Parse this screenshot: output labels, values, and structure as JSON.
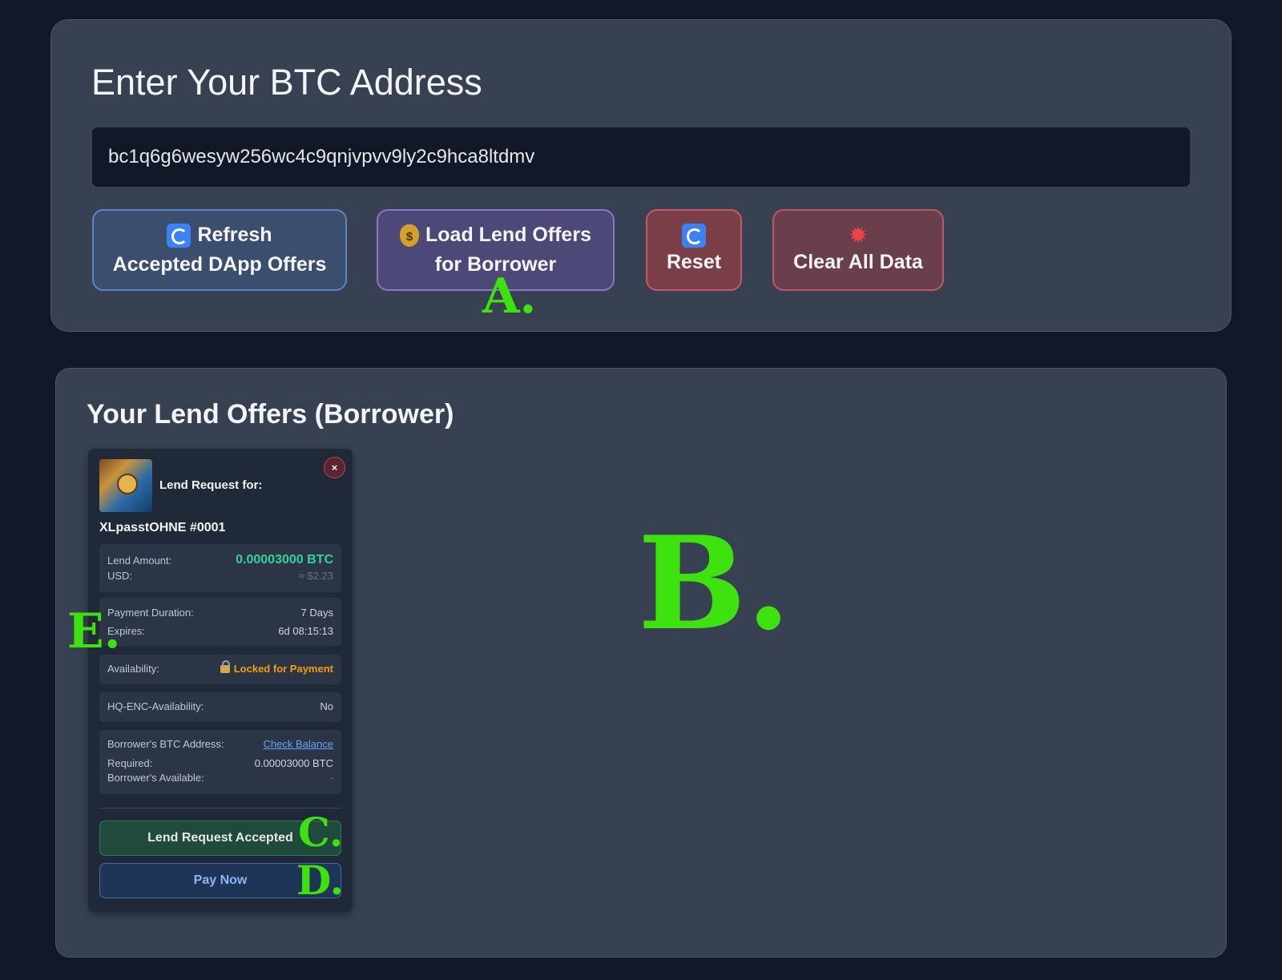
{
  "address_panel": {
    "title": "Enter Your BTC Address",
    "address_value": "bc1q6g6wesyw256wc4c9qnjvpvv9ly2c9hca8ltdmv",
    "buttons": {
      "refresh_line1": "Refresh",
      "refresh_line2": "Accepted DApp Offers",
      "load_line1": "Load Lend Offers",
      "load_line2": "for Borrower",
      "reset": "Reset",
      "clear": "Clear All Data"
    },
    "icons": {
      "money_glyph": "$",
      "boom_glyph": "✹"
    }
  },
  "offers_panel": {
    "title": "Your Lend Offers (Borrower)",
    "card": {
      "header": "Lend Request for:",
      "close_glyph": "×",
      "nft_name": "XLpasstOHNE #0001",
      "lend_amount_label": "Lend Amount:",
      "lend_amount_value": "0.00003000 BTC",
      "usd_label": "USD:",
      "usd_value": "≈ $2.23",
      "duration_label": "Payment Duration:",
      "duration_value": "7 Days",
      "expires_label": "Expires:",
      "expires_value": "6d 08:15:13",
      "availability_label": "Availability:",
      "availability_value": "Locked for Payment",
      "hq_label": "HQ-ENC-Availability:",
      "hq_value": "No",
      "borrower_addr_label": "Borrower's BTC Address:",
      "check_balance": "Check Balance",
      "required_label": "Required:",
      "required_value": "0.00003000 BTC",
      "borrower_available_label": "Borrower's Available:",
      "borrower_available_value": "-",
      "accepted_button": "Lend Request Accepted",
      "pay_button": "Pay Now"
    }
  },
  "annotations": {
    "A": "A.",
    "B": "B.",
    "C": "C.",
    "D": "D.",
    "E": "E."
  },
  "colors": {
    "background": "#111827",
    "panel": "#374151",
    "accent_green": "#34d399",
    "warning": "#f59e0b",
    "link": "#60a5fa",
    "annotation": "#3ee20f"
  }
}
